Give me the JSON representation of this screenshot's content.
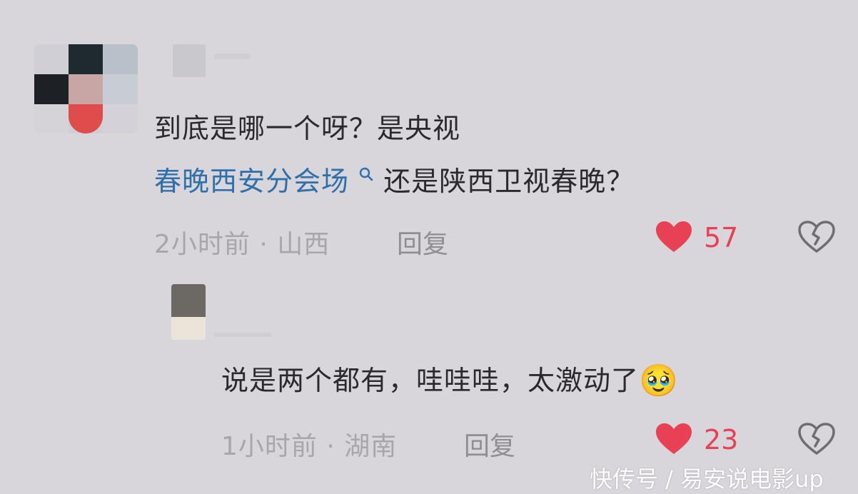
{
  "comment": {
    "text_line1": "到底是哪一个呀？是央视",
    "topic_link": "春晚西安分会场",
    "text_line2_rest": "还是陕西卫视春晚？",
    "time": "2小时前",
    "separator": " · ",
    "location": "山西",
    "reply_label": "回复",
    "likes": "57"
  },
  "reply": {
    "text": "说是两个都有，哇哇哇，太激动了",
    "emoji": "🥹",
    "time": "1小时前",
    "separator": " · ",
    "location": "湖南",
    "reply_label": "回复",
    "likes": "23"
  },
  "watermark": "快传号 / 易安说电影up",
  "colors": {
    "background": "#d8d6da",
    "topic_link": "#2f6faa",
    "like_red": "#e84055",
    "meta_gray": "#a7a6ab"
  },
  "icons": {
    "like": "heart-icon",
    "dislike": "broken-heart-icon",
    "topic": "search-icon"
  }
}
